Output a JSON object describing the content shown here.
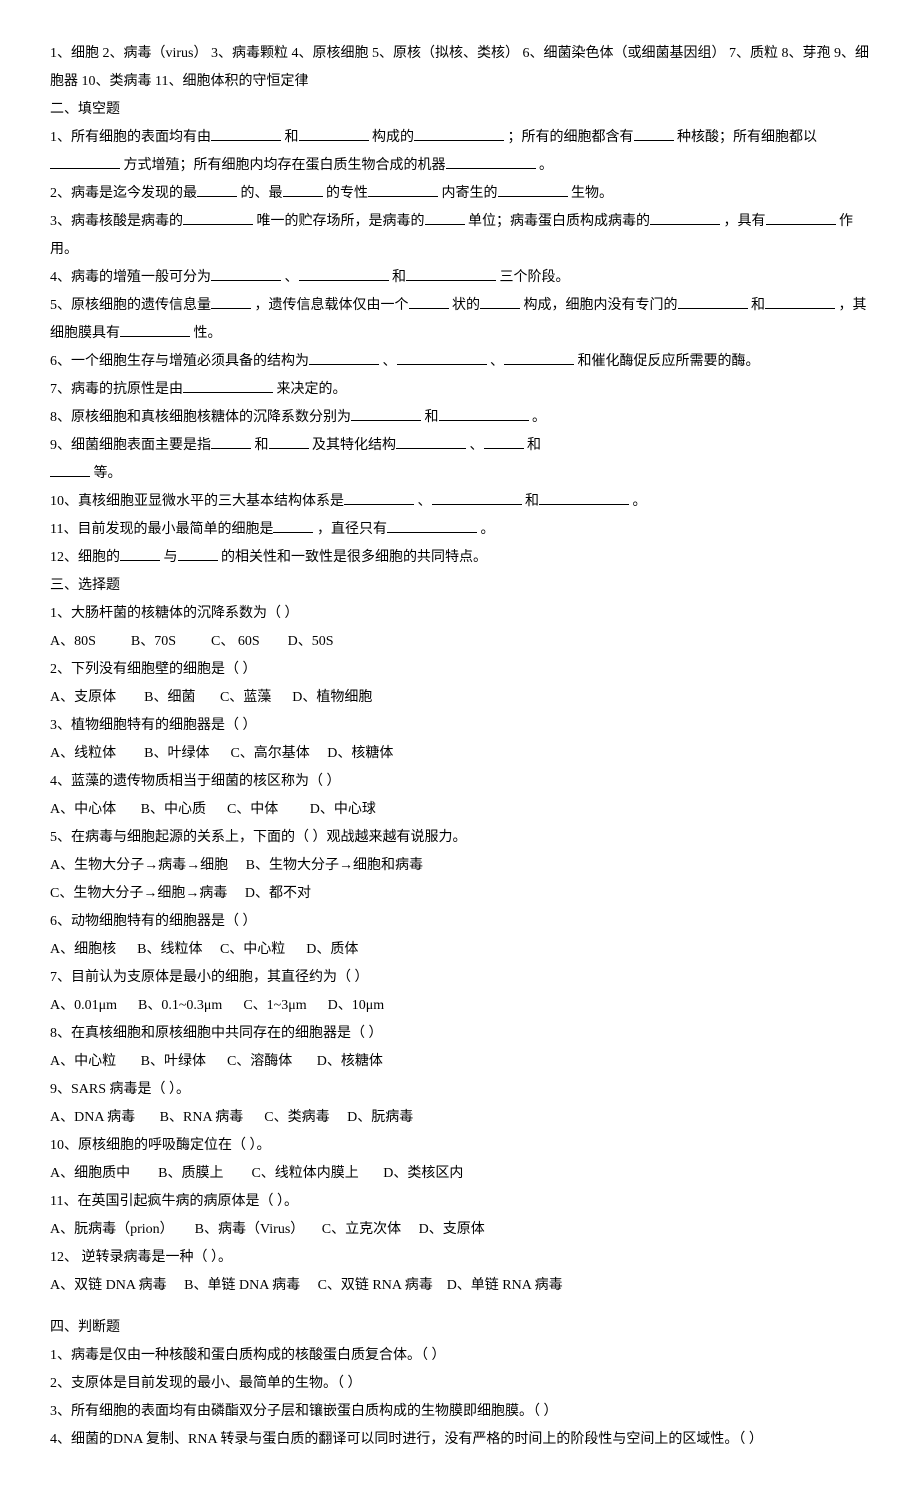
{
  "terms": "1、细胞  2、病毒（virus） 3、病毒颗粒  4、原核细胞   5、原核（拟核、类核） 6、细菌染色体（或细菌基因组）  7、质粒   8、芽孢   9、细胞器  10、类病毒 11、细胞体积的守恒定律",
  "section2_title": "二、填空题",
  "fill": {
    "q1a": "1、所有细胞的表面均有由",
    "q1b": "和",
    "q1c": "构成的",
    "q1d": "；所有的细胞都含有",
    "q1e": "种核酸；所有细胞都以",
    "q1f": "方式增殖；所有细胞内均存在蛋白质生物合成的机器",
    "q1g": "。",
    "q2a": "2、病毒是迄今发现的最",
    "q2b": "的、最",
    "q2c": "的专性",
    "q2d": "内寄生的",
    "q2e": "生物。",
    "q3a": "3、病毒核酸是病毒的",
    "q3b": "唯一的贮存场所，是病毒的",
    "q3c": "单位；病毒蛋白质构成病毒的",
    "q3d": "，具有",
    "q3e": "作用。",
    "q4a": "4、病毒的增殖一般可分为",
    "q4b": "、",
    "q4c": "和",
    "q4d": "三个阶段。",
    "q5a": "5、原核细胞的遗传信息量",
    "q5b": "，遗传信息载体仅由一个",
    "q5c": "状的",
    "q5d": "构成，细胞内没有专门的",
    "q5e": "和",
    "q5f": "，其细胞膜具有",
    "q5g": "性。",
    "q6a": "6、一个细胞生存与增殖必须具备的结构为",
    "q6b": "、",
    "q6c": "、",
    "q6d": "和催化酶促反应所需要的酶。",
    "q7a": "7、病毒的抗原性是由",
    "q7b": "来决定的。",
    "q8a": "8、原核细胞和真核细胞核糖体的沉降系数分别为",
    "q8b": "和",
    "q8c": "。",
    "q9a": "9、细菌细胞表面主要是指",
    "q9b": "和",
    "q9c": "及其特化结构",
    "q9d": "、",
    "q9e": "和",
    "q9f": "等。",
    "q10a": "10、真核细胞亚显微水平的三大基本结构体系是",
    "q10b": "、",
    "q10c": "和",
    "q10d": "。",
    "q11a": "11、目前发现的最小最简单的细胞是",
    "q11b": "，直径只有",
    "q11c": "。",
    "q12a": "12、细胞的",
    "q12b": "与",
    "q12c": "的相关性和一致性是很多细胞的共同特点。"
  },
  "section3_title": "三、选择题",
  "mc": {
    "q1": "1、大肠杆菌的核糖体的沉降系数为（    ）",
    "q1c": "A、80S          B、70S          C、 60S        D、50S",
    "q2": "2、下列没有细胞壁的细胞是（    ）",
    "q2c": "A、支原体        B、细菌       C、蓝藻      D、植物细胞",
    "q3": "3、植物细胞特有的细胞器是（    ）",
    "q3c": "A、线粒体        B、叶绿体      C、高尔基体     D、核糖体",
    "q4": "4、蓝藻的遗传物质相当于细菌的核区称为（    ）",
    "q4c": "A、中心体       B、中心质      C、中体         D、中心球",
    "q5": "5、在病毒与细胞起源的关系上，下面的（    ）观战越来越有说服力。",
    "q5c1": "A、生物大分子→病毒→细胞     B、生物大分子→细胞和病毒",
    "q5c2": "C、生物大分子→细胞→病毒     D、都不对",
    "q6": "6、动物细胞特有的细胞器是（    ）",
    "q6c": "A、细胞核      B、线粒体     C、中心粒      D、质体",
    "q7": "7、目前认为支原体是最小的细胞，其直径约为（    ）",
    "q7c": "A、0.01μm      B、0.1~0.3μm      C、1~3μm      D、10μm",
    "q8": "8、在真核细胞和原核细胞中共同存在的细胞器是（    ）",
    "q8c": "A、中心粒       B、叶绿体      C、溶酶体       D、核糖体",
    "q9": "9、SARS 病毒是（    ）。",
    "q9c": "A、DNA 病毒       B、RNA 病毒      C、类病毒     D、朊病毒",
    "q10": "10、原核细胞的呼吸酶定位在（    ）。",
    "q10c": "A、细胞质中        B、质膜上        C、线粒体内膜上       D、类核区内",
    "q11": "11、在英国引起疯牛病的病原体是（    ）。",
    "q11c": "A、朊病毒（prion）      B、病毒（Virus）     C、立克次体     D、支原体",
    "q12": "12、 逆转录病毒是一种（    ）。",
    "q12c": "A、双链 DNA 病毒     B、单链 DNA 病毒     C、双链 RNA 病毒    D、单链 RNA 病毒"
  },
  "section4_title": "四、判断题",
  "tf": {
    "q1": "1、病毒是仅由一种核酸和蛋白质构成的核酸蛋白质复合体。（    ）",
    "q2": "2、支原体是目前发现的最小、最简单的生物。（    ）",
    "q3": "3、所有细胞的表面均有由磷酯双分子层和镶嵌蛋白质构成的生物膜即细胞膜。（    ）",
    "q4": "4、细菌的DNA 复制、RNA 转录与蛋白质的翻译可以同时进行，没有严格的时间上的阶段性与空间上的区域性。（    ）"
  }
}
